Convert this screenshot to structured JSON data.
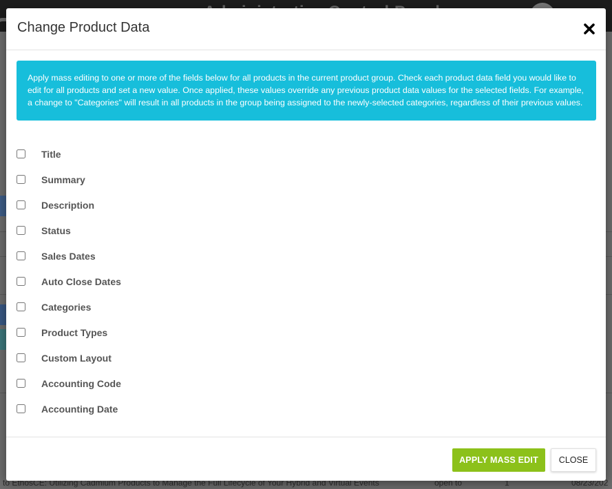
{
  "background": {
    "header_title": "Administrative Control Panel",
    "bottom_row_text": "to EthosCE: Utilizing Cadmium Products to Manage the Full Lifecycle of Your Hybrid and Virtual Events",
    "bottom_row_status": "open to",
    "bottom_row_count": "1",
    "bottom_row_date": "08/23/202"
  },
  "modal": {
    "title": "Change Product Data",
    "close_icon": "close-x-icon",
    "info_text": "Apply mass editing to one or more of the fields below for all products in the current product group. Check each product data field you would like to edit for all products and set a new value. Once applied, these values override any previous product data values for the selected fields. For example, a change to \"Categories\" will result in all products in the group being assigned to the newly-selected categories, regardless of their previous values.",
    "fields": [
      {
        "label": "Title",
        "checked": false
      },
      {
        "label": "Summary",
        "checked": false
      },
      {
        "label": "Description",
        "checked": false
      },
      {
        "label": "Status",
        "checked": false
      },
      {
        "label": "Sales Dates",
        "checked": false
      },
      {
        "label": "Auto Close Dates",
        "checked": false
      },
      {
        "label": "Categories",
        "checked": false
      },
      {
        "label": "Product Types",
        "checked": false
      },
      {
        "label": "Custom Layout",
        "checked": false
      },
      {
        "label": "Accounting Code",
        "checked": false
      },
      {
        "label": "Accounting Date",
        "checked": false
      }
    ],
    "apply_label": "APPLY MASS EDIT",
    "close_label": "CLOSE"
  },
  "colors": {
    "info_bg": "#17bedb",
    "apply_bg": "#8cc11a",
    "overlay": "#6f6f6f"
  }
}
